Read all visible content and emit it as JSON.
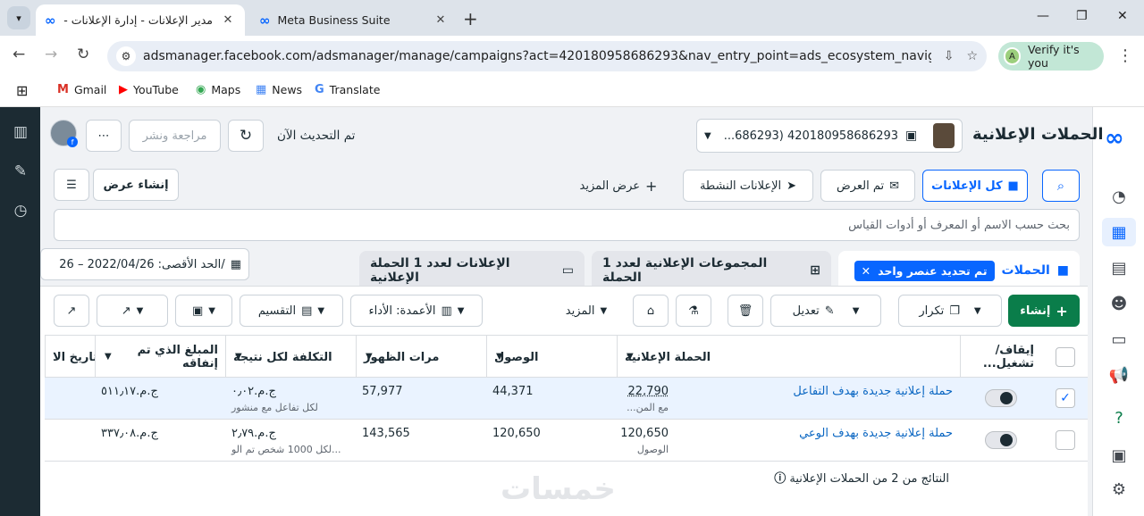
{
  "browser": {
    "tabs": [
      {
        "title": "مدير الإعلانات - إدارة الإعلانات - ا",
        "active": true
      },
      {
        "title": "Meta Business Suite",
        "active": false
      }
    ],
    "url": "adsmanager.facebook.com/adsmanager/manage/campaigns?act=420180958686293&nav_entry_point=ads_ecosystem_navigation_menu&d...",
    "verify_label": "Verify it's you",
    "verify_avatar": "A",
    "bookmarks": [
      "Gmail",
      "YouTube",
      "Maps",
      "News",
      "Translate"
    ]
  },
  "header": {
    "title": "الحملات الإعلانية",
    "account": "420180958686293 (686293...",
    "updated": "تم التحديث الآن",
    "review_publish": "مراجعة ونشر",
    "more": "⋯"
  },
  "filters": {
    "all_ads": "كل الإعلانات",
    "viewed": "تم العرض",
    "active_ads": "الإعلانات النشطة",
    "show_more": "عرض المزيد",
    "create_view": "إنشاء عرض",
    "search_placeholder": "بحث حسب الاسم أو المعرف أو أدوات القياس"
  },
  "tabs": {
    "campaigns": "الحملات",
    "selected_chip": "تم تحديد عنصر واحد",
    "adsets": "المجموعات الإعلانية لعدد 1 الحملة",
    "ads": "الإعلانات لعدد 1 الحملة الإعلانية",
    "date_range": "الحد الأقصى: 2022/04/26 – 26/"
  },
  "toolbar": {
    "create": "إنشاء",
    "duplicate": "تكرار",
    "edit": "تعديل",
    "more": "المزيد",
    "columns": "الأعمدة: الأداء",
    "breakdown": "التقسيم"
  },
  "table": {
    "columns": [
      "إيقاف/ تشغيل...",
      "الحملة الإعلانية",
      "الوصول",
      "مرات الظهور",
      "التكلفة لكل نتيجة",
      "المبلغ الذي تم إنفاقه",
      "تاريخ الا"
    ],
    "rows": [
      {
        "name": "حملة إعلانية جديدة بهدف التفاعل",
        "results": "22,790",
        "results_sub": "مع المن...",
        "reach": "44,371",
        "impressions": "57,977",
        "cost": "ج.م.٠٫٠٢",
        "cost_sub": "لكل تفاعل مع منشور",
        "spent": "ج.م.٥١١٫١٧",
        "checked": true
      },
      {
        "name": "حملة إعلانية جديدة بهدف الوعي",
        "results": "120,650",
        "results_sub": "الوصول",
        "reach": "120,650",
        "impressions": "143,565",
        "cost": "ج.م.٢٫٧٩",
        "cost_sub": "لكل 1000 شخص تم الو...",
        "spent": "ج.م.٣٣٧٫٠٨",
        "checked": false
      }
    ],
    "summary": "النتائج من 2 من الحملات الإعلانية"
  },
  "watermark": "خمسات",
  "colors": {
    "brand": "#0866ff",
    "create": "#0a7d4a",
    "sidebar": "#1c2b33"
  }
}
